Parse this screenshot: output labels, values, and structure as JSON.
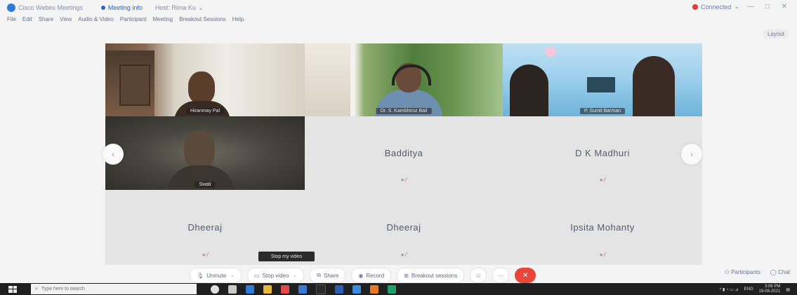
{
  "window": {
    "title": "Cisco Webex Meetings",
    "title_extra": "",
    "meeting_info_label": "Meeting info",
    "host_label": "Host: Rima Ku",
    "recording_label": "Connected",
    "minimize": "—",
    "maximize": "□",
    "close": "✕"
  },
  "menu": {
    "items": [
      "File",
      "Edit",
      "Share",
      "View",
      "Audio & Video",
      "Participant",
      "Meeting",
      "Breakout Sessions",
      "Help"
    ]
  },
  "view_button": "Layout",
  "grid": {
    "tiles": [
      {
        "type": "video",
        "name": "Hiranmay Pal"
      },
      {
        "type": "video",
        "name": "Dr. S. Kambhiroz Bail"
      },
      {
        "type": "video",
        "name": "P. Sumit Barman"
      },
      {
        "type": "video",
        "name": "Swati"
      },
      {
        "type": "avatar",
        "name": "Badditya"
      },
      {
        "type": "avatar",
        "name": "D K Madhuri"
      },
      {
        "type": "avatar",
        "name": "Dheeraj"
      },
      {
        "type": "avatar",
        "name": "Dheeraj"
      },
      {
        "type": "avatar",
        "name": "Ipsita Mohanty"
      }
    ]
  },
  "tooltip": "Stop my video",
  "controls": {
    "unmute": "Unmute",
    "stop_video": "Stop video",
    "share": "Share",
    "record": "Record",
    "breakout": "Breakout sessions",
    "more": "···",
    "leave": "✕",
    "participants": "Participants",
    "chat": "Chat"
  },
  "taskbar": {
    "search_placeholder": "Type here to search",
    "time": "3:06 PM",
    "date": "19-08-2021",
    "lang": "ENG"
  },
  "colors": {
    "leave": "#e8463a",
    "active_border": "#5fb7e8",
    "recording": "#e23b3b"
  }
}
